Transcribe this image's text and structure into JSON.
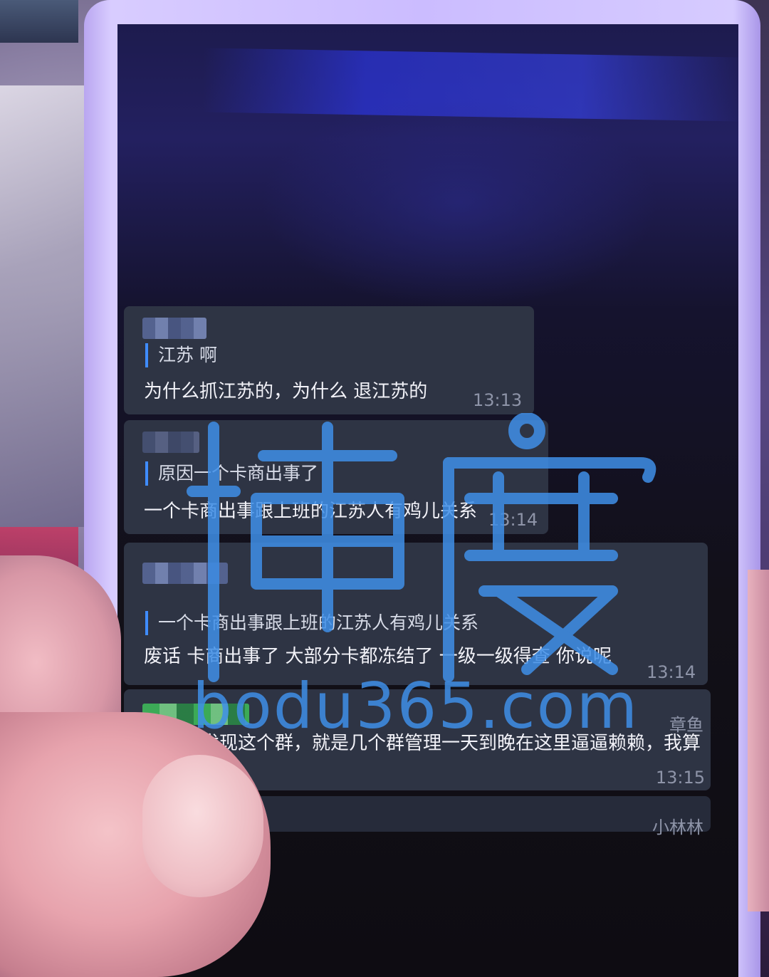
{
  "messages": [
    {
      "quote": "江苏 啊",
      "text": "为什么抓江苏的，为什么  退江苏的",
      "time": "13:13"
    },
    {
      "quote": "原因一个卡商出事了",
      "text": "一个卡商出事跟上班的江苏人有鸡儿关系",
      "time": "13:14"
    },
    {
      "quote": "一个卡商出事跟上班的江苏人有鸡儿关系",
      "text": "废话  卡商出事了  大部分卡都冻结了  一级一级得查  你说呢",
      "time": "13:14"
    },
    {
      "sender_right": "章鱼",
      "text": "我忽然发现这个群，就是几个群管理一天到晚在这里逼逼赖赖，我算什么东西",
      "time": "13:15"
    },
    {
      "sender_right": "小林林"
    }
  ],
  "watermark": {
    "logo_text": "博度",
    "url": "bodu365.com",
    "color": "#3f8fe8"
  }
}
